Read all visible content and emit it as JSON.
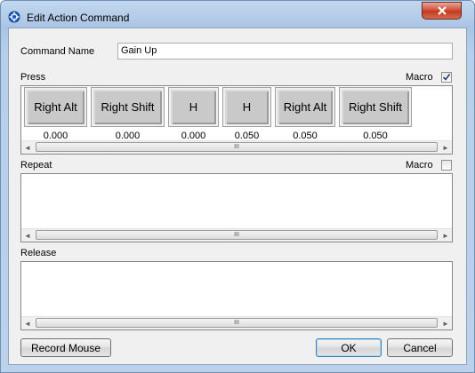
{
  "window": {
    "title": "Edit Action Command"
  },
  "command_name": {
    "label": "Command Name",
    "value": "Gain Up"
  },
  "press": {
    "label": "Press",
    "macro_label": "Macro",
    "macro_checked": true,
    "keys": [
      {
        "label": "Right Alt",
        "value": "0.000"
      },
      {
        "label": "Right Shift",
        "value": "0.000"
      },
      {
        "label": "H",
        "value": "0.000"
      },
      {
        "label": "H",
        "value": "0.050"
      },
      {
        "label": "Right Alt",
        "value": "0.050"
      },
      {
        "label": "Right Shift",
        "value": "0.050"
      }
    ]
  },
  "repeat": {
    "label": "Repeat",
    "macro_label": "Macro",
    "macro_checked": false
  },
  "release": {
    "label": "Release"
  },
  "scroll_glyphs": {
    "left": "◄",
    "right": "►",
    "grip": "III"
  },
  "buttons": {
    "record_mouse": "Record Mouse",
    "ok": "OK",
    "cancel": "Cancel"
  }
}
